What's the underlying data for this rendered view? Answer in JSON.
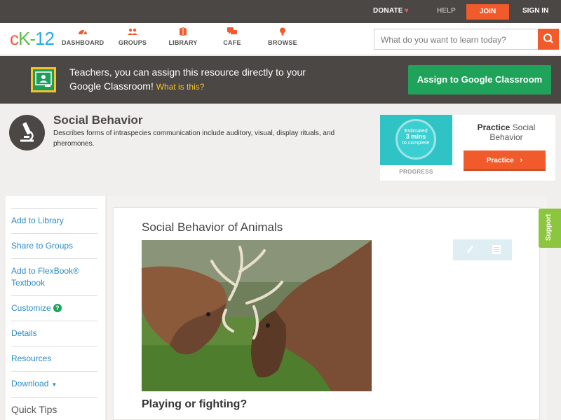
{
  "topbar": {
    "donate": "DONATE",
    "help": "HELP",
    "join": "JOIN",
    "signin": "SIGN IN"
  },
  "nav": {
    "logo_c": "c",
    "logo_k": "K",
    "logo_dash": "-",
    "logo_num": "12",
    "items": [
      {
        "label": "DASHBOARD",
        "icon": "dashboard-icon"
      },
      {
        "label": "GROUPS",
        "icon": "groups-icon"
      },
      {
        "label": "LIBRARY",
        "icon": "library-icon"
      },
      {
        "label": "CAFE",
        "icon": "cafe-icon"
      },
      {
        "label": "BROWSE",
        "icon": "browse-icon"
      }
    ],
    "search_placeholder": "What do you want to learn today?"
  },
  "banner": {
    "message": "Teachers, you can assign this resource directly to your Google Classroom!",
    "what_link": "What is this?",
    "assign_button": "Assign to Google Classroom"
  },
  "concept": {
    "title": "Social Behavior",
    "description": "Describes forms of intraspecies communication include auditory, visual, display rituals, and pheromones."
  },
  "practice": {
    "estimated_line1": "Estimated",
    "estimated_line2": "3 mins",
    "estimated_line3": "to complete",
    "progress_label": "PROGRESS",
    "title_bold": "Practice",
    "title_rest": "Social Behavior",
    "button": "Practice"
  },
  "sidebar": {
    "items": [
      {
        "label": "Add to Library"
      },
      {
        "label": "Share to Groups"
      },
      {
        "label": "Add to FlexBook® Textbook"
      },
      {
        "label": "Customize"
      },
      {
        "label": "Details"
      },
      {
        "label": "Resources"
      },
      {
        "label": "Download"
      }
    ],
    "quick_tips": "Quick Tips"
  },
  "article": {
    "title": "Social Behavior of Animals",
    "subheading": "Playing or fighting?"
  },
  "support": "Support",
  "colors": {
    "accent": "#f15a2b",
    "dark": "#4a4744",
    "green": "#1fa25a",
    "link": "#2b8cc4"
  }
}
